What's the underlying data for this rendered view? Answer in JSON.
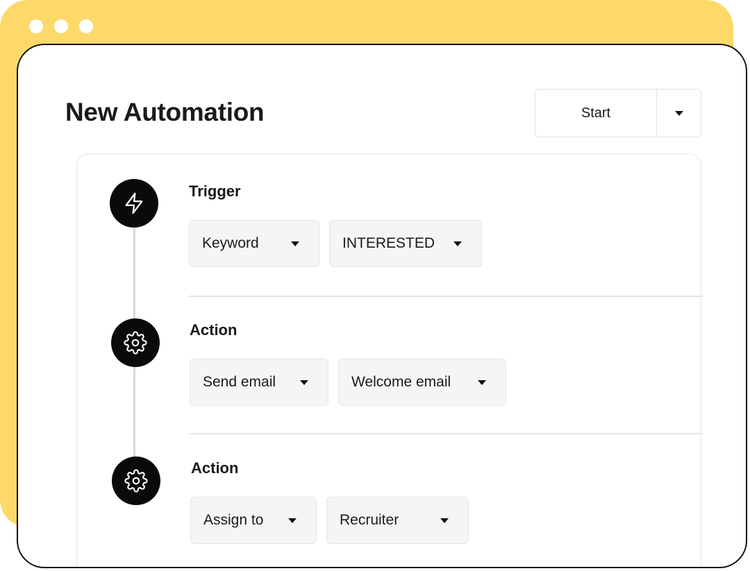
{
  "page": {
    "title": "New Automation"
  },
  "toolbar": {
    "start_label": "Start"
  },
  "steps": [
    {
      "title": "Trigger",
      "icon": "lightning-icon",
      "selects": [
        "Keyword",
        "INTERESTED"
      ]
    },
    {
      "title": "Action",
      "icon": "gear-icon",
      "selects": [
        "Send email",
        "Welcome email"
      ]
    },
    {
      "title": "Action",
      "icon": "gear-icon",
      "selects": [
        "Assign to",
        "Recruiter"
      ]
    }
  ],
  "colors": {
    "accent": "#fdd96a",
    "icon_bg": "#0a0a0a",
    "select_bg": "#f5f5f5"
  }
}
